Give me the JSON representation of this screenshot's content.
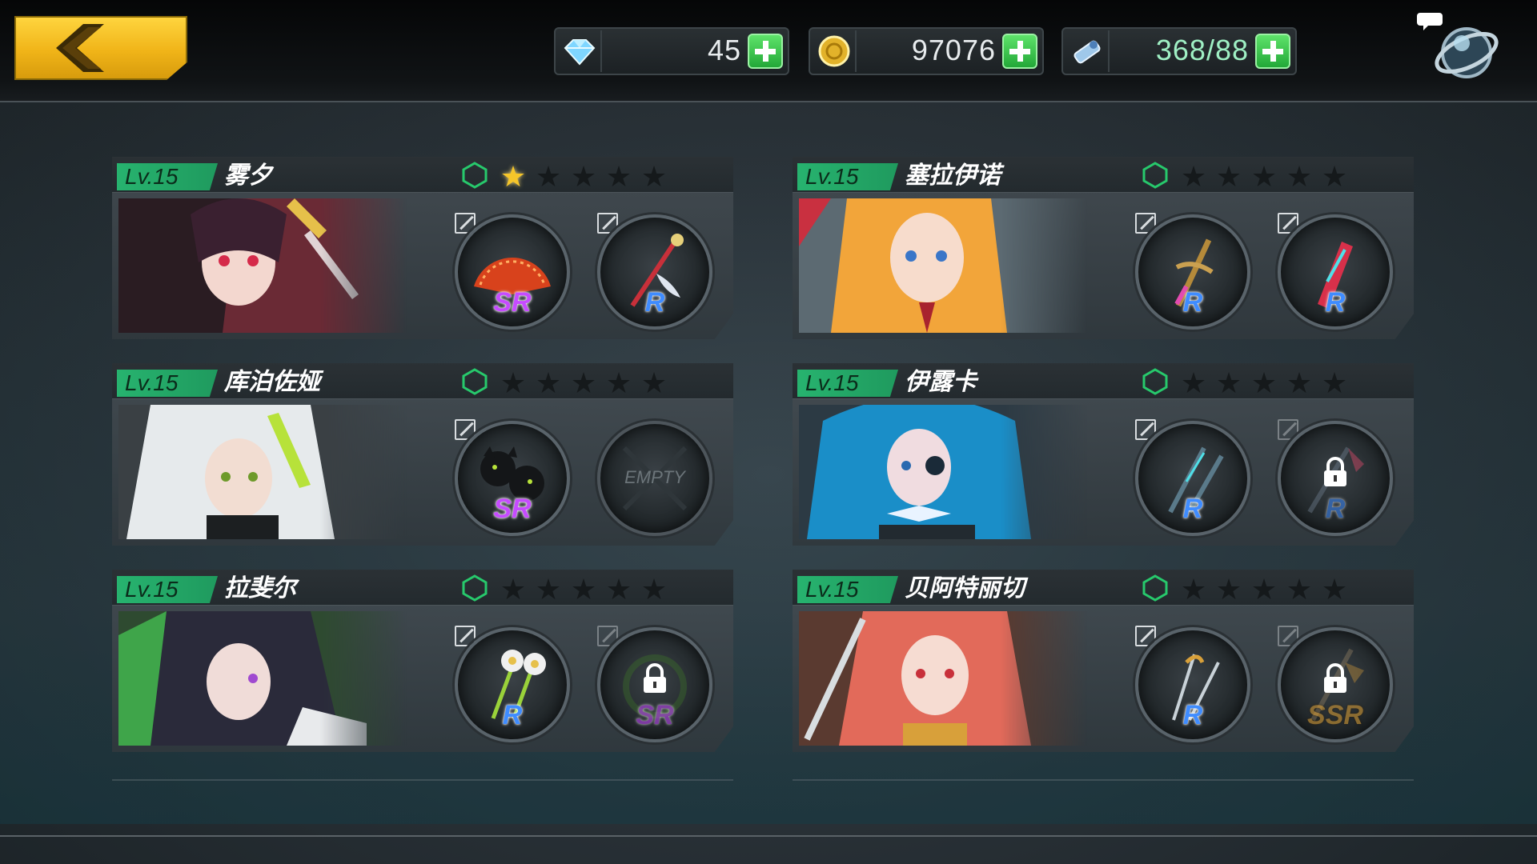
{
  "resources": {
    "gems": {
      "icon": "crystal-icon",
      "value": "45"
    },
    "gold": {
      "icon": "coin-icon",
      "value": "97076"
    },
    "stamina": {
      "icon": "ticket-icon",
      "value": "368/88"
    }
  },
  "colors": {
    "gold_button": "#f0b418",
    "level_badge": "#27b36f",
    "sr": "#c64bff",
    "r": "#3f8cff",
    "ssr": "#e0a236",
    "plus": "#2fbf45"
  },
  "characters": [
    {
      "level": "Lv.15",
      "name": "雾夕",
      "stars_filled": 1,
      "stars_total": 5,
      "weapons": [
        {
          "rarity": "SR",
          "state": "equipped"
        },
        {
          "rarity": "R",
          "state": "equipped"
        }
      ]
    },
    {
      "level": "Lv.15",
      "name": "塞拉伊诺",
      "stars_filled": 0,
      "stars_total": 5,
      "weapons": [
        {
          "rarity": "R",
          "state": "equipped"
        },
        {
          "rarity": "R",
          "state": "equipped"
        }
      ]
    },
    {
      "level": "Lv.15",
      "name": "库泊佐娅",
      "stars_filled": 0,
      "stars_total": 5,
      "weapons": [
        {
          "rarity": "SR",
          "state": "equipped"
        },
        {
          "label": "EMPTY",
          "state": "empty"
        }
      ]
    },
    {
      "level": "Lv.15",
      "name": "伊露卡",
      "stars_filled": 0,
      "stars_total": 5,
      "weapons": [
        {
          "rarity": "R",
          "state": "equipped"
        },
        {
          "rarity": "R",
          "state": "locked"
        }
      ]
    },
    {
      "level": "Lv.15",
      "name": "拉斐尔",
      "stars_filled": 0,
      "stars_total": 5,
      "weapons": [
        {
          "rarity": "R",
          "state": "equipped"
        },
        {
          "rarity": "SR",
          "state": "locked"
        }
      ]
    },
    {
      "level": "Lv.15",
      "name": "贝阿特丽切",
      "stars_filled": 0,
      "stars_total": 5,
      "weapons": [
        {
          "rarity": "R",
          "state": "equipped"
        },
        {
          "rarity": "SSR",
          "state": "locked"
        }
      ]
    }
  ]
}
